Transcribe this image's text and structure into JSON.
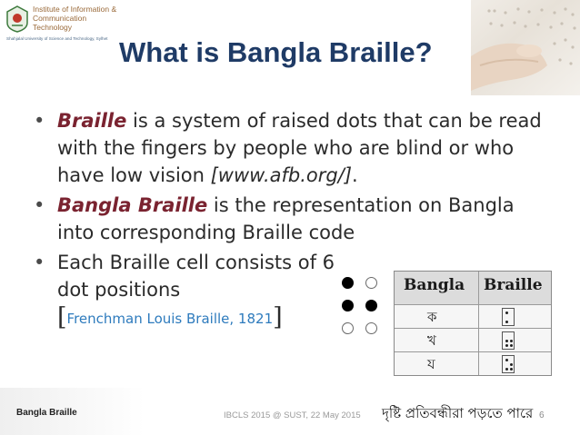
{
  "logo": {
    "line1": "Institute of Information &",
    "line2": "Communication",
    "line3": "Technology",
    "subtitle": "Shahjalal University of Science and Technology, Sylhet"
  },
  "slide": {
    "title": "What is Bangla Braille?",
    "bullets": [
      {
        "term": "Braille",
        "text": " is a system of raised dots that can be read with the fingers by people who are blind or who have low vision ",
        "ref": "[www.afb.org/]",
        "end": "."
      },
      {
        "term": "Bangla Braille",
        "text": " is the representation on Bangla into corresponding Braille code"
      },
      {
        "text": "Each Braille cell consists of 6 dot positions",
        "bracket_open": "[",
        "citation": "Frenchman Louis Braille, 1821",
        "bracket_close": "]"
      }
    ],
    "bullet_symbol": "•"
  },
  "braille_cell": {
    "dots": [
      1,
      0,
      1,
      1,
      0,
      0
    ]
  },
  "table": {
    "headers": [
      "Bangla",
      "Braille"
    ],
    "rows": [
      {
        "bangla": "ক",
        "dots": [
          1,
          0,
          0,
          0,
          1,
          0
        ]
      },
      {
        "bangla": "খ",
        "dots": [
          0,
          0,
          1,
          1,
          1,
          1
        ]
      },
      {
        "bangla": "য",
        "dots": [
          1,
          0,
          0,
          1,
          1,
          1
        ]
      }
    ]
  },
  "footer": {
    "left": "Bangla Braille",
    "center": "IBCLS 2015 @ SUST, 22 May 2015",
    "slogan": "দৃষ্টি প্রতিবন্ধীরা পড়তে পারে",
    "page_number": "6"
  },
  "colors": {
    "title": "#1f3b66",
    "term": "#7a2330",
    "citation": "#2e7bbd"
  }
}
